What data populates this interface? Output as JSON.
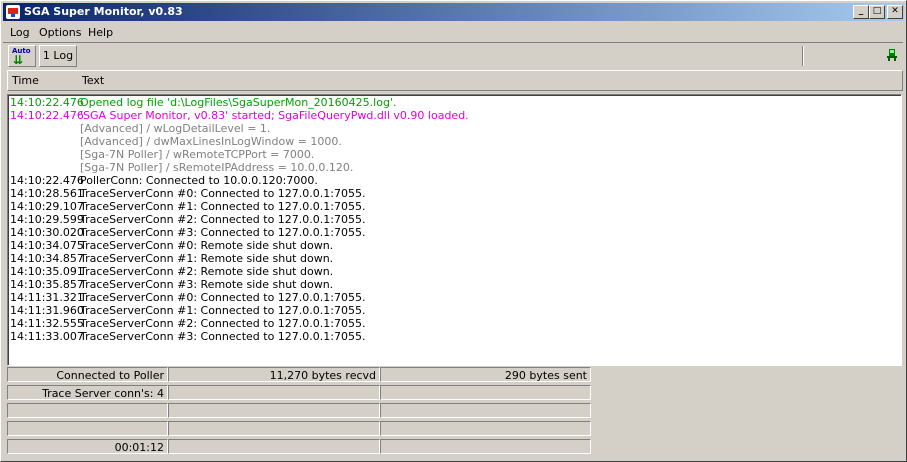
{
  "window": {
    "title": "SGA Super Monitor, v0.83"
  },
  "title_buttons": {
    "minimize": "_",
    "maximize": "□",
    "close": "✕"
  },
  "menu": [
    {
      "label": "Log"
    },
    {
      "label": "Options"
    },
    {
      "label": "Help"
    }
  ],
  "toolbar": {
    "auto_label": "Auto",
    "log_label": "1 Log"
  },
  "columns": {
    "time": "Time",
    "text": "Text"
  },
  "log": [
    {
      "time": "14:10:22.476",
      "text": "Opened log file 'd:\\LogFiles\\SgaSuperMon_20160425.log'.",
      "color": "#00a000"
    },
    {
      "time": "14:10:22.476",
      "text": "'SGA Super Monitor, v0.83' started; SgaFileQueryPwd.dll v0.90 loaded.",
      "color": "#e000e0"
    },
    {
      "time": "",
      "text": "[Advanced] / wLogDetailLevel = 1.",
      "color": "#808080"
    },
    {
      "time": "",
      "text": "[Advanced] / dwMaxLinesInLogWindow = 1000.",
      "color": "#808080"
    },
    {
      "time": "",
      "text": "[Sga-7N Poller] / wRemoteTCPPort = 7000.",
      "color": "#808080"
    },
    {
      "time": "",
      "text": "[Sga-7N Poller] / sRemoteIPAddress = 10.0.0.120.",
      "color": "#808080"
    },
    {
      "time": "14:10:22.476",
      "text": "PollerConn: Connected to 10.0.0.120:7000.",
      "color": "#000000"
    },
    {
      "time": "14:10:28.561",
      "text": "TraceServerConn #0: Connected to 127.0.0.1:7055.",
      "color": "#000000"
    },
    {
      "time": "14:10:29.107",
      "text": "TraceServerConn #1: Connected to 127.0.0.1:7055.",
      "color": "#000000"
    },
    {
      "time": "14:10:29.599",
      "text": "TraceServerConn #2: Connected to 127.0.0.1:7055.",
      "color": "#000000"
    },
    {
      "time": "14:10:30.020",
      "text": "TraceServerConn #3: Connected to 127.0.0.1:7055.",
      "color": "#000000"
    },
    {
      "time": "14:10:34.075",
      "text": "TraceServerConn #0: Remote side shut down.",
      "color": "#000000"
    },
    {
      "time": "14:10:34.857",
      "text": "TraceServerConn #1: Remote side shut down.",
      "color": "#000000"
    },
    {
      "time": "14:10:35.091",
      "text": "TraceServerConn #2: Remote side shut down.",
      "color": "#000000"
    },
    {
      "time": "14:10:35.857",
      "text": "TraceServerConn #3: Remote side shut down.",
      "color": "#000000"
    },
    {
      "time": "14:11:31.321",
      "text": "TraceServerConn #0: Connected to 127.0.0.1:7055.",
      "color": "#000000"
    },
    {
      "time": "14:11:31.960",
      "text": "TraceServerConn #1: Connected to 127.0.0.1:7055.",
      "color": "#000000"
    },
    {
      "time": "14:11:32.555",
      "text": "TraceServerConn #2: Connected to 127.0.0.1:7055.",
      "color": "#000000"
    },
    {
      "time": "14:11:33.007",
      "text": "TraceServerConn #3: Connected to 127.0.0.1:7055.",
      "color": "#000000"
    }
  ],
  "status": [
    [
      "Connected to Poller",
      "11,270 bytes recvd",
      "290 bytes sent"
    ],
    [
      "Trace Server conn's: 4",
      "",
      ""
    ],
    [
      "",
      "",
      ""
    ],
    [
      "",
      "",
      ""
    ],
    [
      "00:01:12",
      "",
      ""
    ]
  ]
}
